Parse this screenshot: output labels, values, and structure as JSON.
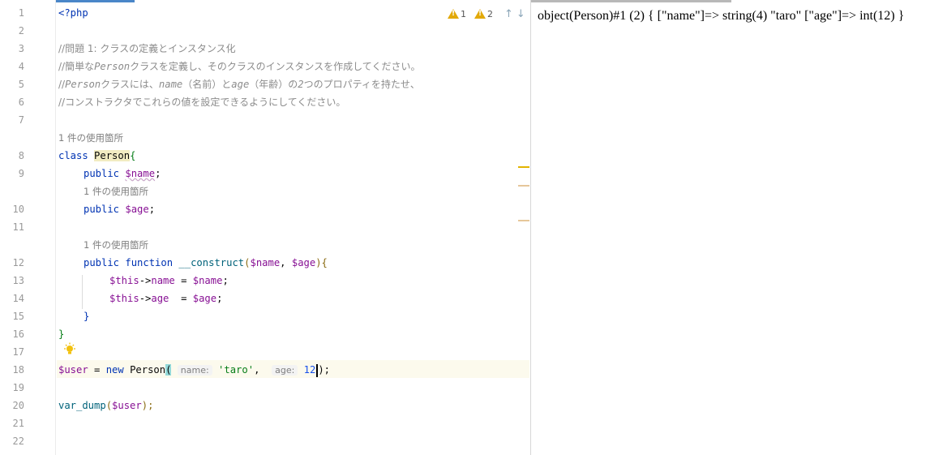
{
  "editor": {
    "line_numbers": [
      "1",
      "2",
      "3",
      "4",
      "5",
      "6",
      "7",
      "8",
      "9",
      "10",
      "11",
      "12",
      "13",
      "14",
      "15",
      "16",
      "17",
      "18",
      "19",
      "20",
      "21",
      "22"
    ],
    "inspections": {
      "warning_count": "1",
      "weak_warning_count": "2",
      "up_arrow": "↑",
      "down_arrow": "↓"
    },
    "code": {
      "l1_open_tag": "<?php",
      "l3_comment": "//問題 1: クラスの定義とインスタンス化",
      "l4_a": "//簡単な",
      "l4_b": "Person",
      "l4_c": "クラスを定義し、そのクラスのインスタンスを作成してください。",
      "l5_a": "//",
      "l5_b": "Person",
      "l5_c": "クラスには、",
      "l5_d": "name",
      "l5_e": "（名前）と",
      "l5_f": "age",
      "l5_g": "（年齢）の",
      "l5_h": "2",
      "l5_i": "つのプロパティを持たせ、",
      "l6_comment": "//コンストラクタでこれらの値を設定できるようにしてください。",
      "usage_hint_class": "1 件の使用箇所",
      "kw_class": "class",
      "class_name": "Person",
      "brace_open": "{",
      "kw_public": "public",
      "prop_name": "$name",
      "semicolon": ";",
      "usage_hint_age": "1 件の使用箇所",
      "prop_age": "$age",
      "usage_hint_construct": "1 件の使用箇所",
      "kw_function": "function",
      "fn_construct": "__construct",
      "param_open": "(",
      "param_name": "$name",
      "comma": ", ",
      "param_age": "$age",
      "param_close": "){",
      "this_1": "$this",
      "arrow": "->",
      "field_name": "name",
      "assign": " = ",
      "assign_age": "  = ",
      "this_2": "$this",
      "field_age": "age",
      "val_name": "$name",
      "val_age": "$age",
      "inner_brace_close": "}",
      "outer_brace_close": "}",
      "var_user": "$user",
      "eq": " = ",
      "kw_new": "new",
      "new_class": "Person",
      "call_open": "(",
      "inlay_name": "name:",
      "arg_taro": "'taro'",
      "arg_comma": ",",
      "inlay_age": "age:",
      "arg_12": "12",
      "call_close": ");",
      "fn_var_dump": "var_dump",
      "dump_open": "(",
      "dump_var": "$user",
      "dump_close": ");"
    }
  },
  "output": {
    "text": "object(Person)#1 (2) { [\"name\"]=> string(4) \"taro\" [\"age\"]=> int(12) }"
  },
  "colors": {
    "warning": "#e2a908",
    "current_line": "#fcfaed",
    "brace_match": "#93d9d9",
    "class_highlight": "#f2ecc2"
  }
}
